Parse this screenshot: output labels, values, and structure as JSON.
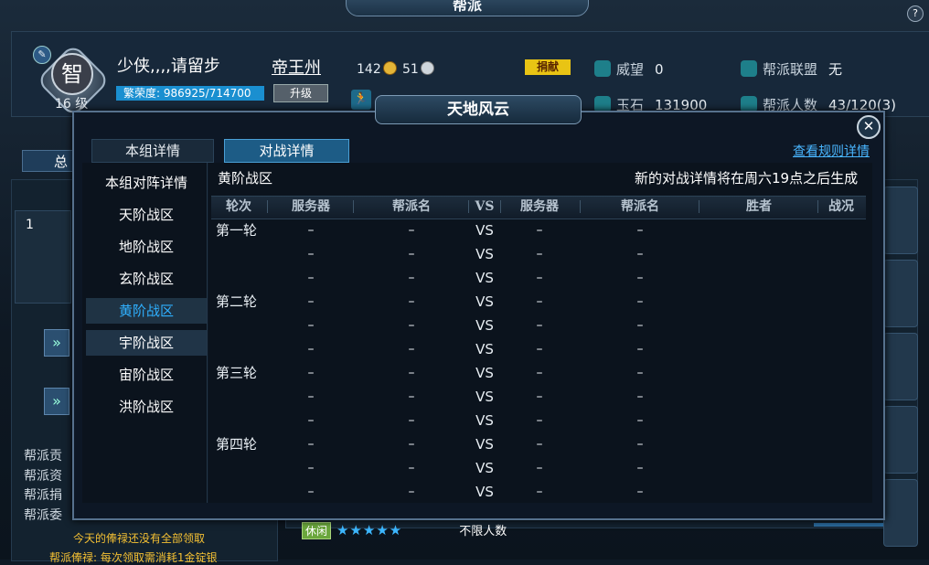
{
  "background": {
    "window_title": "帮派",
    "avatar_char": "智",
    "level": "16 级",
    "player_name": "少侠,,,,请留步",
    "prosperity": "繁荣度: 986925/714700",
    "upgrade_label": "升级",
    "guild_name": "帝王州",
    "coin_gold": "142",
    "coin_silver": "51",
    "donate_label": "捐献",
    "prestige": {
      "label": "威望",
      "value": "0"
    },
    "jade": {
      "label": "玉石",
      "value": "131900"
    },
    "alliance": {
      "label": "帮派联盟",
      "value": "无"
    },
    "members": {
      "label": "帮派人数",
      "value": "43/120(3)"
    },
    "tab_total": "总",
    "rank_number": "1",
    "side_labels": [
      "帮派贡",
      "帮派资",
      "帮派捐",
      "帮派委"
    ],
    "note_line1": "今天的俸禄还没有全部领取",
    "note_line2": "帮派俸禄: 每次领取需消耗1金锭银",
    "leisure_badge": "休闲",
    "stars": "★★★★★",
    "unlimited": "不限人数"
  },
  "dialog": {
    "title": "天地风云",
    "tabs": [
      {
        "label": "本组详情",
        "active": false
      },
      {
        "label": "对战详情",
        "active": true
      }
    ],
    "rules_link": "查看规则详情",
    "nav_items": [
      {
        "label": "本组对阵详情"
      },
      {
        "label": "天阶战区"
      },
      {
        "label": "地阶战区"
      },
      {
        "label": "玄阶战区"
      },
      {
        "label": "黄阶战区"
      },
      {
        "label": "宇阶战区"
      },
      {
        "label": "宙阶战区"
      },
      {
        "label": "洪阶战区"
      }
    ],
    "selected_nav": "黄阶战区",
    "zone_title": "黄阶战区",
    "notice": "新的对战详情将在周六19点之后生成",
    "columns": [
      "轮次",
      "服务器",
      "帮派名",
      "VS",
      "服务器",
      "帮派名",
      "胜者",
      "战况"
    ],
    "rows": [
      {
        "round": "第一轮",
        "server_a": "–",
        "guild_a": "–",
        "vs": "VS",
        "server_b": "–",
        "guild_b": "–"
      },
      {
        "round": "",
        "server_a": "–",
        "guild_a": "–",
        "vs": "VS",
        "server_b": "–",
        "guild_b": "–"
      },
      {
        "round": "",
        "server_a": "–",
        "guild_a": "–",
        "vs": "VS",
        "server_b": "–",
        "guild_b": "–"
      },
      {
        "round": "第二轮",
        "server_a": "–",
        "guild_a": "–",
        "vs": "VS",
        "server_b": "–",
        "guild_b": "–"
      },
      {
        "round": "",
        "server_a": "–",
        "guild_a": "–",
        "vs": "VS",
        "server_b": "–",
        "guild_b": "–"
      },
      {
        "round": "",
        "server_a": "–",
        "guild_a": "–",
        "vs": "VS",
        "server_b": "–",
        "guild_b": "–"
      },
      {
        "round": "第三轮",
        "server_a": "–",
        "guild_a": "–",
        "vs": "VS",
        "server_b": "–",
        "guild_b": "–"
      },
      {
        "round": "",
        "server_a": "–",
        "guild_a": "–",
        "vs": "VS",
        "server_b": "–",
        "guild_b": "–"
      },
      {
        "round": "",
        "server_a": "–",
        "guild_a": "–",
        "vs": "VS",
        "server_b": "–",
        "guild_b": "–"
      },
      {
        "round": "第四轮",
        "server_a": "–",
        "guild_a": "–",
        "vs": "VS",
        "server_b": "–",
        "guild_b": "–"
      },
      {
        "round": "",
        "server_a": "–",
        "guild_a": "–",
        "vs": "VS",
        "server_b": "–",
        "guild_b": "–"
      },
      {
        "round": "",
        "server_a": "–",
        "guild_a": "–",
        "vs": "VS",
        "server_b": "–",
        "guild_b": "–"
      }
    ]
  }
}
